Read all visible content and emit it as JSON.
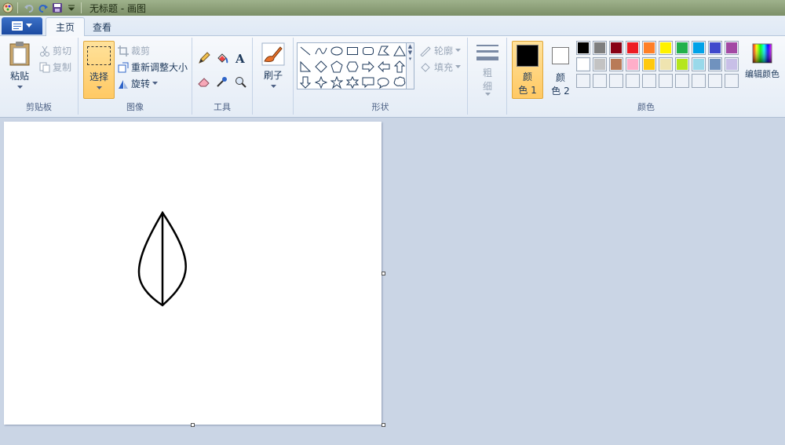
{
  "window": {
    "title": "无标题 - 画图"
  },
  "tabs": [
    {
      "label": "主页"
    },
    {
      "label": "查看"
    }
  ],
  "ribbon": {
    "clipboard": {
      "paste": "粘贴",
      "cut": "剪切",
      "copy": "复制",
      "label": "剪贴板"
    },
    "image": {
      "select": "选择",
      "crop": "裁剪",
      "resize": "重新调整大小",
      "rotate": "旋转",
      "label": "图像"
    },
    "tools": {
      "label": "工具"
    },
    "brush": {
      "label": "刷子"
    },
    "shapes": {
      "outline": "轮廓",
      "fill": "填充",
      "label": "形状"
    },
    "size": {
      "label_top": "粗",
      "label_bottom": "细"
    },
    "colors": {
      "color1_top": "颜",
      "color1_bottom": "色 1",
      "color2_top": "颜",
      "color2_bottom": "色 2",
      "edit": "编辑颜色",
      "label": "颜色",
      "row1": [
        "#000000",
        "#7f7f7f",
        "#880015",
        "#ed1c24",
        "#ff7f27",
        "#fff200",
        "#22b14c",
        "#00a2e8",
        "#3f48cc",
        "#a349a4"
      ],
      "row2": [
        "#ffffff",
        "#c3c3c3",
        "#b97a57",
        "#ffaec9",
        "#ffc90e",
        "#efe4b0",
        "#b5e61d",
        "#99d9ea",
        "#7092be",
        "#c8bfe7"
      ],
      "color1": "#000000",
      "color2": "#ffffff"
    }
  }
}
